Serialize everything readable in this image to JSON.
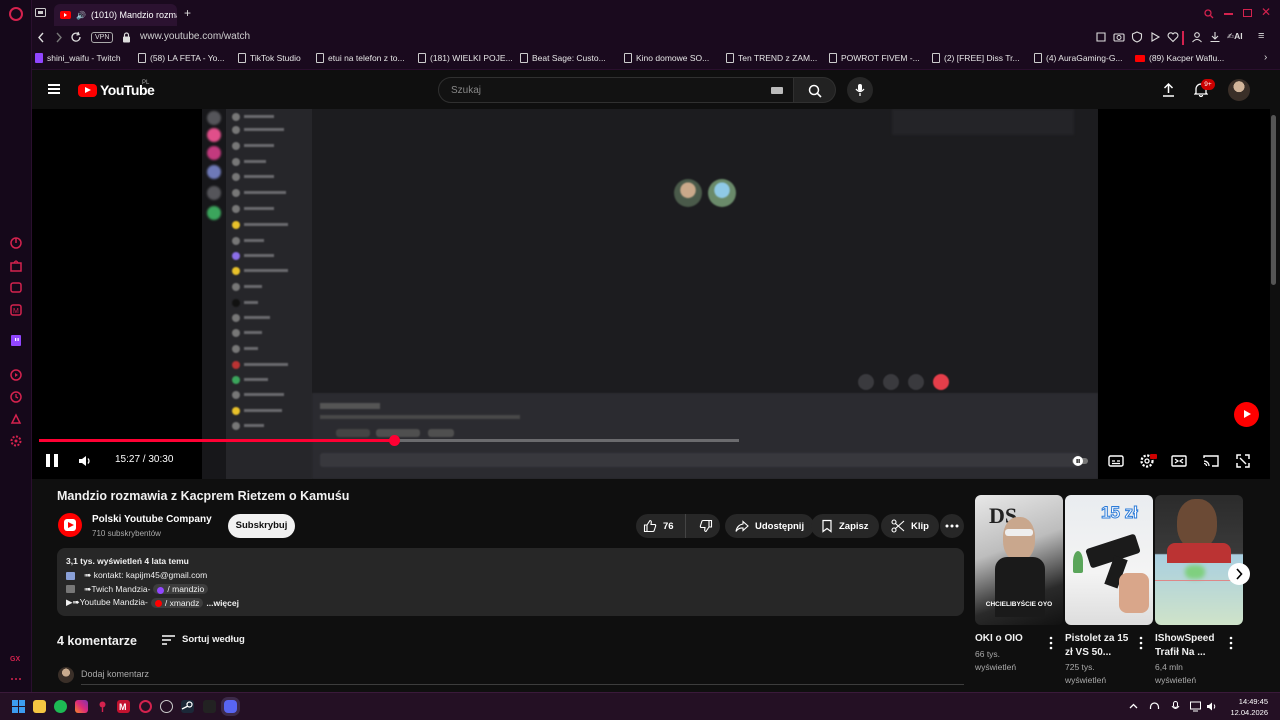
{
  "browser": {
    "active_tab_title": "(1010) Mandzio rozmaw",
    "url": "www.youtube.com/watch",
    "vpn_label": "VPN",
    "bookmarks": [
      {
        "label": "shini_waifu - Twitch",
        "icon": "twitch"
      },
      {
        "label": "(58) LA FETA - Yo...",
        "icon": "page"
      },
      {
        "label": "TikTok Studio",
        "icon": "page"
      },
      {
        "label": "etui na telefon z to...",
        "icon": "page"
      },
      {
        "label": "(181) WIELKI POJE...",
        "icon": "page"
      },
      {
        "label": "Beat Sage: Custo...",
        "icon": "page"
      },
      {
        "label": "Kino domowe SO...",
        "icon": "page"
      },
      {
        "label": "Ten TREND z ZAM...",
        "icon": "page"
      },
      {
        "label": "POWROT FIVEM -...",
        "icon": "page"
      },
      {
        "label": "(2) [FREE] Diss Tr...",
        "icon": "page"
      },
      {
        "label": "(4) AuraGaming-G...",
        "icon": "page"
      },
      {
        "label": "(89) Kacper Waflu...",
        "icon": "youtube"
      }
    ]
  },
  "youtube_header": {
    "logo_text": "YouTube",
    "country_code": "PL",
    "search_placeholder": "Szukaj",
    "notifications_badge": "9+"
  },
  "player": {
    "current_time": "15:27",
    "duration": "30:30",
    "time_display": "15:27 / 30:30",
    "progress": 0.5066,
    "buffered": 0.7
  },
  "video": {
    "title": "Mandzio rozmawia z Kacprem Rietzem o Kamuśu",
    "channel_name": "Polski Youtube Company",
    "subscribers": "710 subskrybentów",
    "subscribe_label": "Subskrybuj",
    "like_count": "76",
    "share_label": "Udostępnij",
    "save_label": "Zapisz",
    "clip_label": "Klip",
    "description": {
      "meta": "3,1 tys. wyświetleń  4 lata temu",
      "line1": "⠀➠ kontakt: kapijm45@gmail.com",
      "line2_prefix": "⠀➠Twich Mandzia-",
      "line2_chip": "/ mandzio",
      "line3_prefix": "▶➠Youtube Mandzia-",
      "line3_chip": "/ xmandz",
      "more_label": "...więcej"
    }
  },
  "comments": {
    "count_label": "4 komentarze",
    "sort_label": "Sortuj według",
    "add_placeholder": "Dodaj komentarz"
  },
  "recommendations": [
    {
      "title": "OKI o OIO",
      "meta1": "66 tys.",
      "meta2": "wyświetleń",
      "thumb_caption": "CHCIELIBYŚCIE OYO"
    },
    {
      "title": "Pistolet za 15 zł VS 50...",
      "meta1": "725 tys.",
      "meta2": "wyświetleń",
      "thumb_caption": "15 zł"
    },
    {
      "title": "IShowSpeed Trafił Na ...",
      "meta1": "6,4 mln",
      "meta2": "wyświetleń",
      "thumb_caption": ""
    }
  ],
  "taskbar": {
    "time": "14:49:45",
    "date": "12.04.2026"
  },
  "colors": {
    "accent_red": "#ff0033",
    "opera_red": "#d4224e",
    "background": "#0f0f0f"
  }
}
